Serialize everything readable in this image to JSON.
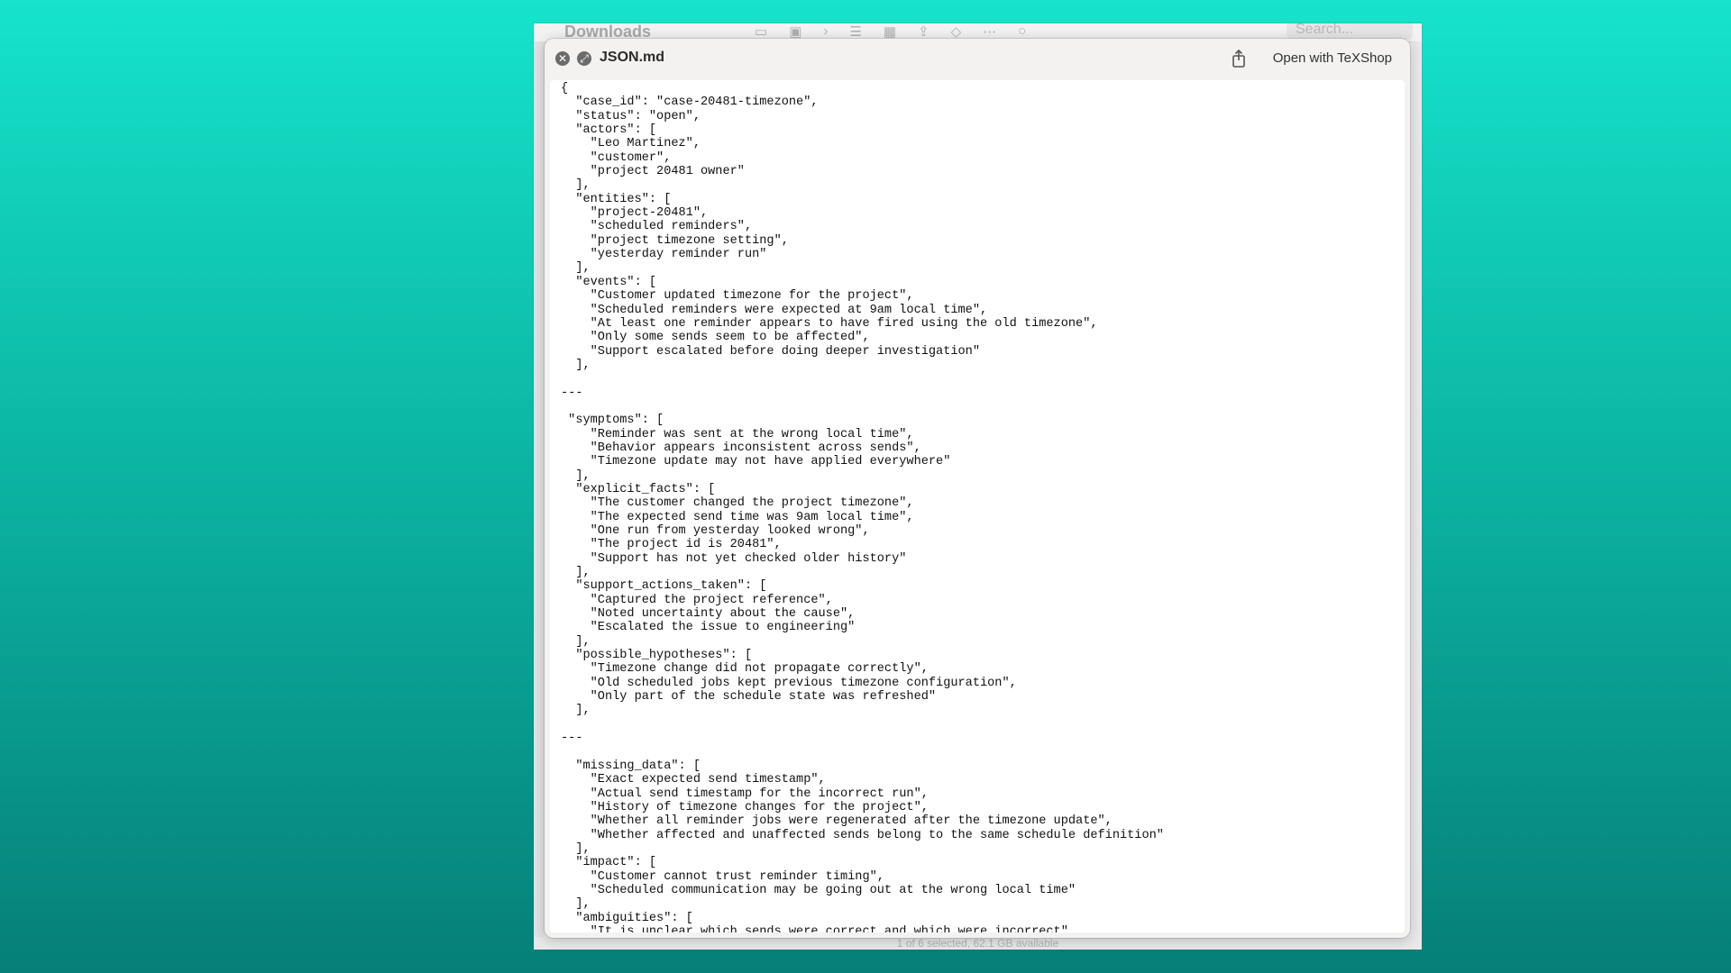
{
  "finder": {
    "title": "Downloads",
    "search_placeholder": "Search...",
    "status": "1 of 6 selected, 62.1 GB available"
  },
  "quicklook": {
    "filename": "JSON.md",
    "open_with_label": "Open with TeXShop"
  },
  "document": {
    "lines": [
      "{",
      "  \"case_id\": \"case-20481-timezone\",",
      "  \"status\": \"open\",",
      "  \"actors\": [",
      "    \"Leo Martinez\",",
      "    \"customer\",",
      "    \"project 20481 owner\"",
      "  ],",
      "  \"entities\": [",
      "    \"project-20481\",",
      "    \"scheduled reminders\",",
      "    \"project timezone setting\",",
      "    \"yesterday reminder run\"",
      "  ],",
      "  \"events\": [",
      "    \"Customer updated timezone for the project\",",
      "    \"Scheduled reminders were expected at 9am local time\",",
      "    \"At least one reminder appears to have fired using the old timezone\",",
      "    \"Only some sends seem to be affected\",",
      "    \"Support escalated before doing deeper investigation\"",
      "  ],",
      "",
      "---",
      "",
      " \"symptoms\": [",
      "    \"Reminder was sent at the wrong local time\",",
      "    \"Behavior appears inconsistent across sends\",",
      "    \"Timezone update may not have applied everywhere\"",
      "  ],",
      "  \"explicit_facts\": [",
      "    \"The customer changed the project timezone\",",
      "    \"The expected send time was 9am local time\",",
      "    \"One run from yesterday looked wrong\",",
      "    \"The project id is 20481\",",
      "    \"Support has not yet checked older history\"",
      "  ],",
      "  \"support_actions_taken\": [",
      "    \"Captured the project reference\",",
      "    \"Noted uncertainty about the cause\",",
      "    \"Escalated the issue to engineering\"",
      "  ],",
      "  \"possible_hypotheses\": [",
      "    \"Timezone change did not propagate correctly\",",
      "    \"Old scheduled jobs kept previous timezone configuration\",",
      "    \"Only part of the schedule state was refreshed\"",
      "  ],",
      "",
      "---",
      "",
      "  \"missing_data\": [",
      "    \"Exact expected send timestamp\",",
      "    \"Actual send timestamp for the incorrect run\",",
      "    \"History of timezone changes for the project\",",
      "    \"Whether all reminder jobs were regenerated after the timezone update\",",
      "    \"Whether affected and unaffected sends belong to the same schedule definition\"",
      "  ],",
      "  \"impact\": [",
      "    \"Customer cannot trust reminder timing\",",
      "    \"Scheduled communication may be going out at the wrong local time\"",
      "  ],",
      "  \"ambiguities\": [",
      "    \"It is unclear which sends were correct and which were incorrect\","
    ]
  },
  "colors": {
    "panel_bg": "#f3f2f1",
    "content_bg": "#ffffff",
    "text": "#111111"
  }
}
